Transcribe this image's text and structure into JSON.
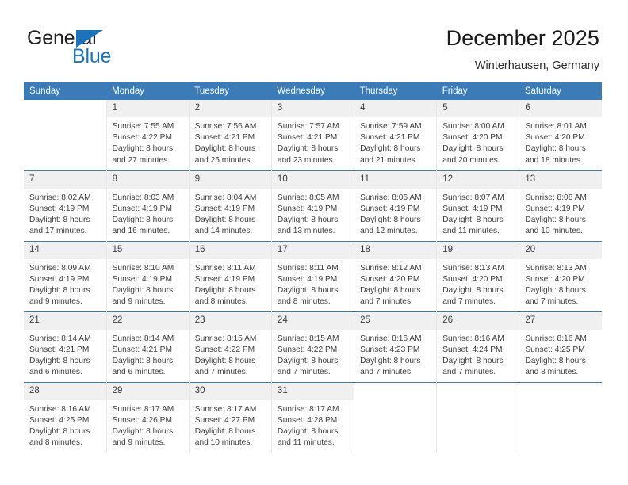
{
  "brand": {
    "name_top": "General",
    "name_bottom": "Blue",
    "triangle_icon": "blue-triangle-logo-mark",
    "color_dark": "#231f20",
    "color_blue": "#1b74bb"
  },
  "header": {
    "title": "December 2025",
    "subtitle": "Winterhausen, Germany"
  },
  "theme": {
    "header_bg": "#3b7cb8",
    "header_text": "#ffffff",
    "daynum_bg": "#f0f0f0",
    "row_separator": "#3b7cb8",
    "cell_separator": "#e8e8e8",
    "body_text": "#3d3d3d"
  },
  "calendar": {
    "columns": [
      "Sunday",
      "Monday",
      "Tuesday",
      "Wednesday",
      "Thursday",
      "Friday",
      "Saturday"
    ],
    "weeks": [
      [
        {
          "empty": true
        },
        {
          "day": "1",
          "l1": "Sunrise: 7:55 AM",
          "l2": "Sunset: 4:22 PM",
          "l3": "Daylight: 8 hours",
          "l4": "and 27 minutes."
        },
        {
          "day": "2",
          "l1": "Sunrise: 7:56 AM",
          "l2": "Sunset: 4:21 PM",
          "l3": "Daylight: 8 hours",
          "l4": "and 25 minutes."
        },
        {
          "day": "3",
          "l1": "Sunrise: 7:57 AM",
          "l2": "Sunset: 4:21 PM",
          "l3": "Daylight: 8 hours",
          "l4": "and 23 minutes."
        },
        {
          "day": "4",
          "l1": "Sunrise: 7:59 AM",
          "l2": "Sunset: 4:21 PM",
          "l3": "Daylight: 8 hours",
          "l4": "and 21 minutes."
        },
        {
          "day": "5",
          "l1": "Sunrise: 8:00 AM",
          "l2": "Sunset: 4:20 PM",
          "l3": "Daylight: 8 hours",
          "l4": "and 20 minutes."
        },
        {
          "day": "6",
          "l1": "Sunrise: 8:01 AM",
          "l2": "Sunset: 4:20 PM",
          "l3": "Daylight: 8 hours",
          "l4": "and 18 minutes."
        }
      ],
      [
        {
          "day": "7",
          "l1": "Sunrise: 8:02 AM",
          "l2": "Sunset: 4:19 PM",
          "l3": "Daylight: 8 hours",
          "l4": "and 17 minutes."
        },
        {
          "day": "8",
          "l1": "Sunrise: 8:03 AM",
          "l2": "Sunset: 4:19 PM",
          "l3": "Daylight: 8 hours",
          "l4": "and 16 minutes."
        },
        {
          "day": "9",
          "l1": "Sunrise: 8:04 AM",
          "l2": "Sunset: 4:19 PM",
          "l3": "Daylight: 8 hours",
          "l4": "and 14 minutes."
        },
        {
          "day": "10",
          "l1": "Sunrise: 8:05 AM",
          "l2": "Sunset: 4:19 PM",
          "l3": "Daylight: 8 hours",
          "l4": "and 13 minutes."
        },
        {
          "day": "11",
          "l1": "Sunrise: 8:06 AM",
          "l2": "Sunset: 4:19 PM",
          "l3": "Daylight: 8 hours",
          "l4": "and 12 minutes."
        },
        {
          "day": "12",
          "l1": "Sunrise: 8:07 AM",
          "l2": "Sunset: 4:19 PM",
          "l3": "Daylight: 8 hours",
          "l4": "and 11 minutes."
        },
        {
          "day": "13",
          "l1": "Sunrise: 8:08 AM",
          "l2": "Sunset: 4:19 PM",
          "l3": "Daylight: 8 hours",
          "l4": "and 10 minutes."
        }
      ],
      [
        {
          "day": "14",
          "l1": "Sunrise: 8:09 AM",
          "l2": "Sunset: 4:19 PM",
          "l3": "Daylight: 8 hours",
          "l4": "and 9 minutes."
        },
        {
          "day": "15",
          "l1": "Sunrise: 8:10 AM",
          "l2": "Sunset: 4:19 PM",
          "l3": "Daylight: 8 hours",
          "l4": "and 9 minutes."
        },
        {
          "day": "16",
          "l1": "Sunrise: 8:11 AM",
          "l2": "Sunset: 4:19 PM",
          "l3": "Daylight: 8 hours",
          "l4": "and 8 minutes."
        },
        {
          "day": "17",
          "l1": "Sunrise: 8:11 AM",
          "l2": "Sunset: 4:19 PM",
          "l3": "Daylight: 8 hours",
          "l4": "and 8 minutes."
        },
        {
          "day": "18",
          "l1": "Sunrise: 8:12 AM",
          "l2": "Sunset: 4:20 PM",
          "l3": "Daylight: 8 hours",
          "l4": "and 7 minutes."
        },
        {
          "day": "19",
          "l1": "Sunrise: 8:13 AM",
          "l2": "Sunset: 4:20 PM",
          "l3": "Daylight: 8 hours",
          "l4": "and 7 minutes."
        },
        {
          "day": "20",
          "l1": "Sunrise: 8:13 AM",
          "l2": "Sunset: 4:20 PM",
          "l3": "Daylight: 8 hours",
          "l4": "and 7 minutes."
        }
      ],
      [
        {
          "day": "21",
          "l1": "Sunrise: 8:14 AM",
          "l2": "Sunset: 4:21 PM",
          "l3": "Daylight: 8 hours",
          "l4": "and 6 minutes."
        },
        {
          "day": "22",
          "l1": "Sunrise: 8:14 AM",
          "l2": "Sunset: 4:21 PM",
          "l3": "Daylight: 8 hours",
          "l4": "and 6 minutes."
        },
        {
          "day": "23",
          "l1": "Sunrise: 8:15 AM",
          "l2": "Sunset: 4:22 PM",
          "l3": "Daylight: 8 hours",
          "l4": "and 7 minutes."
        },
        {
          "day": "24",
          "l1": "Sunrise: 8:15 AM",
          "l2": "Sunset: 4:22 PM",
          "l3": "Daylight: 8 hours",
          "l4": "and 7 minutes."
        },
        {
          "day": "25",
          "l1": "Sunrise: 8:16 AM",
          "l2": "Sunset: 4:23 PM",
          "l3": "Daylight: 8 hours",
          "l4": "and 7 minutes."
        },
        {
          "day": "26",
          "l1": "Sunrise: 8:16 AM",
          "l2": "Sunset: 4:24 PM",
          "l3": "Daylight: 8 hours",
          "l4": "and 7 minutes."
        },
        {
          "day": "27",
          "l1": "Sunrise: 8:16 AM",
          "l2": "Sunset: 4:25 PM",
          "l3": "Daylight: 8 hours",
          "l4": "and 8 minutes."
        }
      ],
      [
        {
          "day": "28",
          "l1": "Sunrise: 8:16 AM",
          "l2": "Sunset: 4:25 PM",
          "l3": "Daylight: 8 hours",
          "l4": "and 8 minutes."
        },
        {
          "day": "29",
          "l1": "Sunrise: 8:17 AM",
          "l2": "Sunset: 4:26 PM",
          "l3": "Daylight: 8 hours",
          "l4": "and 9 minutes."
        },
        {
          "day": "30",
          "l1": "Sunrise: 8:17 AM",
          "l2": "Sunset: 4:27 PM",
          "l3": "Daylight: 8 hours",
          "l4": "and 10 minutes."
        },
        {
          "day": "31",
          "l1": "Sunrise: 8:17 AM",
          "l2": "Sunset: 4:28 PM",
          "l3": "Daylight: 8 hours",
          "l4": "and 11 minutes."
        },
        {
          "empty": true
        },
        {
          "empty": true
        },
        {
          "empty": true
        }
      ]
    ]
  }
}
